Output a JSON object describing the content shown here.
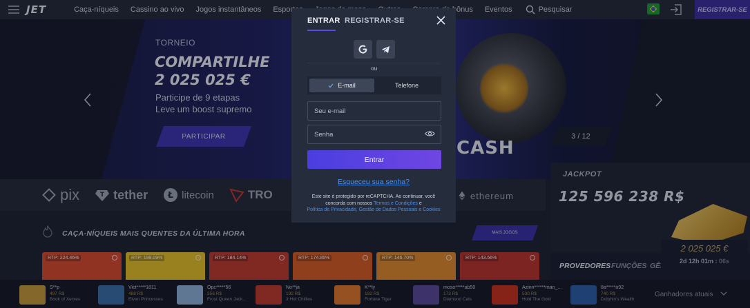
{
  "header": {
    "logo": "JET",
    "nav": [
      "Caça-níqueis",
      "Cassino ao vivo",
      "Jogos instantâneos",
      "Esportes",
      "Jogos de mesa",
      "Outros",
      "Compra de bônus",
      "Eventos"
    ],
    "search_label": "Pesquisar",
    "register_label": "REGISTRAR-SE"
  },
  "hero": {
    "eyebrow": "TORNEIO",
    "headline_1": "COMPARTILHE",
    "headline_2": "2 025 025 €",
    "sub_1": "Participe de 9 etapas",
    "sub_2": "Leve um boost supremo",
    "cta": "PARTICIPAR",
    "counter": "3 / 12",
    "art_word": "CASH"
  },
  "payments": [
    "pix",
    "tether",
    "litecoin",
    "TRO",
    "ethereum"
  ],
  "jackpot": {
    "label": "JACKPOT",
    "amount": "125 596 238 R$",
    "prize": "2 025 025 €",
    "timer": "2d 12h 01m :",
    "timer_seconds": "06s"
  },
  "section": {
    "title": "CAÇA-NÍQUEIS MAIS QUENTES DA ÚLTIMA HORA",
    "more": "MAIS JOGOS"
  },
  "tiles": [
    {
      "rtp": "RTP: 224.46%",
      "color": "#d94a2b"
    },
    {
      "rtp": "RTP: 199.09%",
      "color": "#e6c229"
    },
    {
      "rtp": "RTP: 184.14%",
      "color": "#c0392b"
    },
    {
      "rtp": "RTP: 174.85%",
      "color": "#d95d22"
    },
    {
      "rtp": "RTP: 146.70%",
      "color": "#e08a2c"
    },
    {
      "rtp": "RTP: 143.56%",
      "color": "#b8332a"
    }
  ],
  "provider_tabs": [
    "PROVEDORES",
    "FUNÇÕES",
    "GÊN"
  ],
  "ticker": {
    "winners": [
      {
        "name": "S**p",
        "amount": "497 R$",
        "game": "Book of Xerxes",
        "color": "#c79a3a"
      },
      {
        "name": "Vict*****1811",
        "amount": "488 R$",
        "game": "Elven Princesses",
        "color": "#3a6fa8"
      },
      {
        "name": "Opc*****56",
        "amount": "356 R$",
        "game": "Frost Queen Jack...",
        "color": "#8fb3d9"
      },
      {
        "name": "No**ja",
        "amount": "192 R$",
        "game": "3 Hot Chillies",
        "color": "#c0392b"
      },
      {
        "name": "K**ly",
        "amount": "192 R$",
        "game": "Fortune Tiger",
        "color": "#e0782a"
      },
      {
        "name": "moso*****ab50",
        "amount": "173 R$",
        "game": "Diamond Cats",
        "color": "#5a4a9a"
      },
      {
        "name": "Azinn******man_...",
        "amount": "530 R$",
        "game": "Hold The Gold",
        "color": "#c8321e"
      },
      {
        "name": "8a*****o92",
        "amount": "740 R$",
        "game": "Dolphin's Wealth",
        "color": "#2b5fa8"
      }
    ],
    "label": "Ganhadores atuais"
  },
  "modal": {
    "tab_login": "ENTRAR",
    "tab_register": "REGISTRAR-SE",
    "or": "ou",
    "toggle_email": "E-mail",
    "toggle_phone": "Telefone",
    "email_placeholder": "Seu e-mail",
    "password_placeholder": "Senha",
    "submit": "Entrar",
    "forgot": "Esqueceu sua senha?",
    "legal_1": "Este site é protegido por reCAPTCHA. Ao continuar, você",
    "legal_2": "concorda com nossos",
    "legal_terms": "Termos e Condições",
    "legal_and": "e",
    "legal_privacy": "Política de Privacidade, Gestão de Dados Pessoais e Cookies"
  }
}
